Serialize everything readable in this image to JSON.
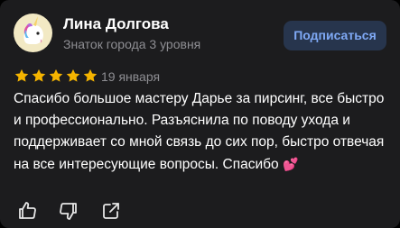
{
  "review": {
    "author": {
      "name": "Лина Долгова",
      "level": "Знаток города 3 уровня",
      "avatar_icon": "unicorn-avatar"
    },
    "subscribe_label": "Подписаться",
    "rating": {
      "value": 5,
      "max": 5,
      "star_color": "#f5b400"
    },
    "date": "19 января",
    "text": "Спасибо большое мастеру Дарье за пирсинг, все быстро и профессионально. Разъяснила по поводу ухода и поддерживает со мной связь до сих пор, быстро отвечая на все интересующие вопросы. Спасибо",
    "text_emoji": "💕",
    "actions": [
      {
        "icon": "thumbs-up-icon"
      },
      {
        "icon": "thumbs-down-icon"
      },
      {
        "icon": "share-icon"
      }
    ]
  },
  "colors": {
    "background": "#1c1c1e",
    "accent_button_bg": "#27354d",
    "accent_button_text": "#7fa9f5",
    "secondary_text": "#8e8e93"
  }
}
